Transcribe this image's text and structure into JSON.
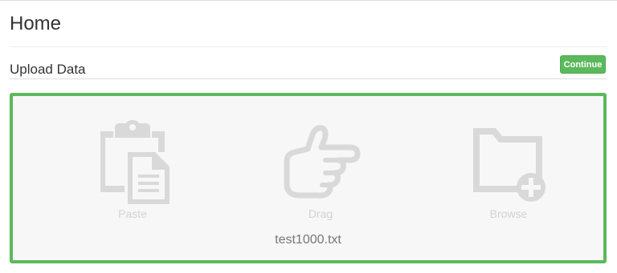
{
  "header": {
    "title": "Home"
  },
  "upload": {
    "title": "Upload Data",
    "continue_label": "Continue"
  },
  "dropzone": {
    "options": [
      {
        "label": "Paste",
        "icon": "clipboard-icon"
      },
      {
        "label": "Drag",
        "icon": "pointing-hand-icon"
      },
      {
        "label": "Browse",
        "icon": "folder-plus-icon"
      }
    ],
    "file_name": "test1000.txt"
  },
  "colors": {
    "accent": "#5cb85c",
    "icon": "#d9d9d9",
    "dropzone_bg": "#f7f7f7"
  }
}
